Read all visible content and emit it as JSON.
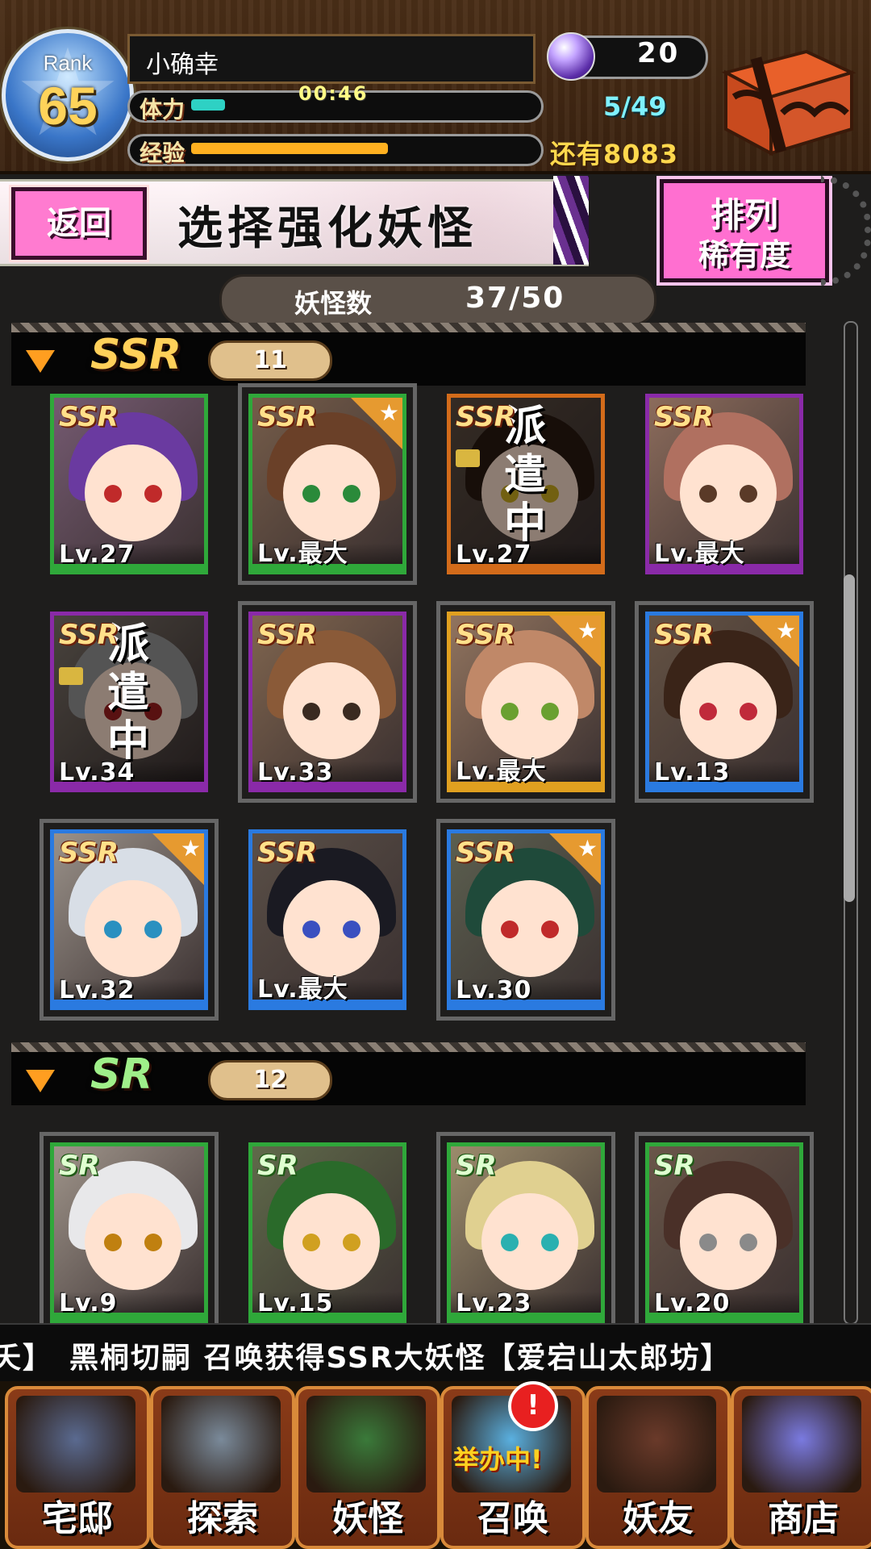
{
  "player": {
    "rank_label": "Rank",
    "rank": "65",
    "name": "小确幸",
    "stamina_label": "体力",
    "stamina_timer": "00:46",
    "stamina_count": "5/49",
    "stamina_fraction": 0.1,
    "exp_label": "经验",
    "exp_remaining": "还有8083",
    "exp_fraction": 0.58,
    "gems": "20"
  },
  "title_bar": {
    "back_label": "返回",
    "title": "选择强化妖怪",
    "sort_line1": "排列",
    "sort_line2": "稀有度"
  },
  "yokai_count": {
    "label": "妖怪数",
    "value": "37/50"
  },
  "sections": [
    {
      "rarity": "SSR",
      "count": "11"
    },
    {
      "rarity": "SR",
      "count": "12"
    }
  ],
  "ssr_cards": [
    {
      "badge": "SSR",
      "level": "Lv.27",
      "frame_color": "#2fa83a",
      "stripe_color": "#2fa83a",
      "hair": "#6a3aa0",
      "eye": "#c02a2a",
      "starred": false,
      "dispatched": false
    },
    {
      "badge": "SSR",
      "level": "Lv.最大",
      "frame_color": "#2fa83a",
      "stripe_color": "#2fa83a",
      "hair": "#6a4028",
      "eye": "#2a8a3a",
      "starred": true,
      "dispatched": false
    },
    {
      "badge": "SSR",
      "level": "Lv.27",
      "frame_color": "#d36b1a",
      "stripe_color": "#d36b1a",
      "hair": "#2a1a12",
      "eye": "#d0b020",
      "starred": false,
      "dispatched": true,
      "dispatch_text": "派遣中"
    },
    {
      "badge": "SSR",
      "level": "Lv.最大",
      "frame_color": "#8a2aa8",
      "stripe_color": "#8a2aa8",
      "hair": "#b07060",
      "eye": "#5a3a28",
      "starred": false,
      "dispatched": false
    },
    {
      "badge": "SSR",
      "level": "Lv.34",
      "frame_color": "#8a2aa8",
      "stripe_color": "#8a2aa8",
      "hair": "#9a9a9a",
      "eye": "#a02020",
      "starred": false,
      "dispatched": true,
      "dispatch_text": "派遣中"
    },
    {
      "badge": "SSR",
      "level": "Lv.33",
      "frame_color": "#8a2aa8",
      "stripe_color": "#8a2aa8",
      "hair": "#8a5a38",
      "eye": "#3a2a20",
      "starred": false,
      "dispatched": false
    },
    {
      "badge": "SSR",
      "level": "Lv.最大",
      "frame_color": "#e0a020",
      "stripe_color": "#e0a020",
      "hair": "#c08868",
      "eye": "#6aa030",
      "starred": true,
      "dispatched": false
    },
    {
      "badge": "SSR",
      "level": "Lv.13",
      "frame_color": "#2a7ae0",
      "stripe_color": "#2a7ae0",
      "hair": "#3a2418",
      "eye": "#c02a3a",
      "starred": true,
      "dispatched": false
    },
    {
      "badge": "SSR",
      "level": "Lv.32",
      "frame_color": "#2a7ae0",
      "stripe_color": "#2a7ae0",
      "hair": "#d8dee6",
      "eye": "#2a90c0",
      "starred": true,
      "dispatched": false
    },
    {
      "badge": "SSR",
      "level": "Lv.最大",
      "frame_color": "#2a7ae0",
      "stripe_color": "#2a7ae0",
      "hair": "#1a1a22",
      "eye": "#3a50c0",
      "starred": false,
      "dispatched": false
    },
    {
      "badge": "SSR",
      "level": "Lv.30",
      "frame_color": "#2a7ae0",
      "stripe_color": "#2a7ae0",
      "hair": "#1f4a3a",
      "eye": "#c02a2a",
      "starred": true,
      "dispatched": false
    }
  ],
  "sr_cards": [
    {
      "badge": "SR",
      "level": "Lv.9",
      "frame_color": "#2fa83a",
      "stripe_color": "#2fa83a",
      "hair": "#e8e8ea",
      "eye": "#c08010",
      "starred": false,
      "dispatched": false
    },
    {
      "badge": "SR",
      "level": "Lv.15",
      "frame_color": "#2fa83a",
      "stripe_color": "#2fa83a",
      "hair": "#2a6a2a",
      "eye": "#d0a020",
      "starred": false,
      "dispatched": false
    },
    {
      "badge": "SR",
      "level": "Lv.23",
      "frame_color": "#2fa83a",
      "stripe_color": "#2fa83a",
      "hair": "#e0d090",
      "eye": "#2ab0b0",
      "starred": false,
      "dispatched": false
    },
    {
      "badge": "SR",
      "level": "Lv.20",
      "frame_color": "#2fa83a",
      "stripe_color": "#2fa83a",
      "hair": "#4a3028",
      "eye": "#8a8a8a",
      "starred": false,
      "dispatched": false
    }
  ],
  "ticker": "夭】　黑桐切嗣 召唤获得SSR大妖怪【爱宕山太郎坊】",
  "nav": [
    {
      "label": "宅邸",
      "icon": "house-icon",
      "color": "#5a6a90"
    },
    {
      "label": "探索",
      "icon": "magnifier-map-icon",
      "color": "#7a8a9a"
    },
    {
      "label": "妖怪",
      "icon": "scroll-icon",
      "color": "#3a7a3a"
    },
    {
      "label": "召唤",
      "icon": "summon-star-icon",
      "color": "#5ab0e0",
      "sub": "举办中!",
      "badge": "!"
    },
    {
      "label": "妖友",
      "icon": "fox-girl-icon",
      "color": "#6a3a2a"
    },
    {
      "label": "商店",
      "icon": "crystal-orb-icon",
      "color": "#7a7ae0"
    }
  ],
  "colors": {
    "accent_pink": "#ff7bd0",
    "stamina_fill": "#2ed1c4",
    "exp_fill": "#ffb020"
  }
}
